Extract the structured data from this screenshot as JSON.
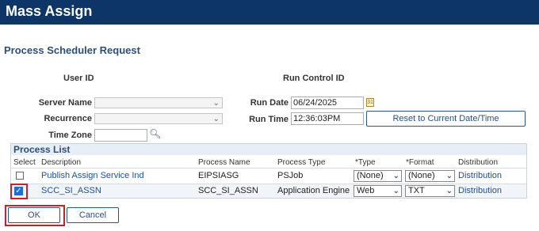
{
  "header": {
    "title": "Mass Assign"
  },
  "section_title": "Process Scheduler Request",
  "labels": {
    "user_id": "User ID",
    "run_control_id": "Run Control ID",
    "server_name": "Server Name",
    "recurrence": "Recurrence",
    "time_zone": "Time Zone",
    "run_date": "Run Date",
    "run_time": "Run Time"
  },
  "fields": {
    "run_date": "06/24/2025",
    "run_time": "12:36:03PM",
    "server_name": "",
    "recurrence": "",
    "time_zone": ""
  },
  "buttons": {
    "reset": "Reset to Current Date/Time",
    "ok": "OK",
    "cancel": "Cancel"
  },
  "process_list": {
    "title": "Process List",
    "columns": [
      "Select",
      "Description",
      "Process Name",
      "Process Type",
      "*Type",
      "*Format",
      "Distribution"
    ],
    "rows": [
      {
        "selected": false,
        "description": "Publish Assign Service Ind",
        "process_name": "EIPSIASG",
        "process_type": "PSJob",
        "type": "(None)",
        "format": "(None)",
        "distribution": "Distribution"
      },
      {
        "selected": true,
        "description": "SCC_SI_ASSN",
        "process_name": "SCC_SI_ASSN",
        "process_type": "Application Engine",
        "type": "Web",
        "format": "TXT",
        "distribution": "Distribution"
      }
    ]
  },
  "colors": {
    "header_bg": "#0d3567",
    "link": "#1c4f9c",
    "highlight": "#c6202a",
    "checkbox_checked": "#1a6fd6"
  },
  "icons": {
    "calendar": "calendar-icon",
    "search": "search-icon",
    "dropdown": "chevron-down-icon"
  }
}
